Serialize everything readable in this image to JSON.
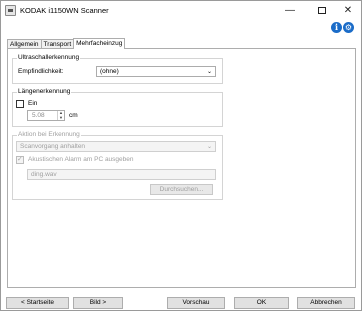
{
  "window": {
    "title": "KODAK i1150WN Scanner",
    "minimize_glyph": "—",
    "close_glyph": "✕"
  },
  "header": {
    "help_icon_glyph": "i",
    "settings_icon_glyph": "⚙"
  },
  "tabs": [
    {
      "label": "Allgemein",
      "active": false
    },
    {
      "label": "Transport",
      "active": false
    },
    {
      "label": "Mehrfacheinzug",
      "active": true
    }
  ],
  "ultrasonic": {
    "title": "Ultraschallerkennung",
    "sensitivity_label": "Empfindlichkeit:",
    "sensitivity_value": "(ohne)"
  },
  "length": {
    "title": "Längenerkennung",
    "enable_label": "Ein",
    "enabled": false,
    "value": "5.08",
    "unit": "cm"
  },
  "action": {
    "title": "Aktion bei Erkennung",
    "action_value": "Scanvorgang anhalten",
    "alarm_label": "Akustischen Alarm am PC ausgeben",
    "alarm_checked": true,
    "sound_file": "ding.wav",
    "browse_label": "Durchsuchen..."
  },
  "footer": {
    "home_label": "< Startseite",
    "image_label": "Bild >",
    "preview_label": "Vorschau",
    "ok_label": "OK",
    "cancel_label": "Abbrechen"
  },
  "colors": {
    "accent_blue": "#1b6cc8",
    "disabled_text": "#a0a0a0"
  }
}
